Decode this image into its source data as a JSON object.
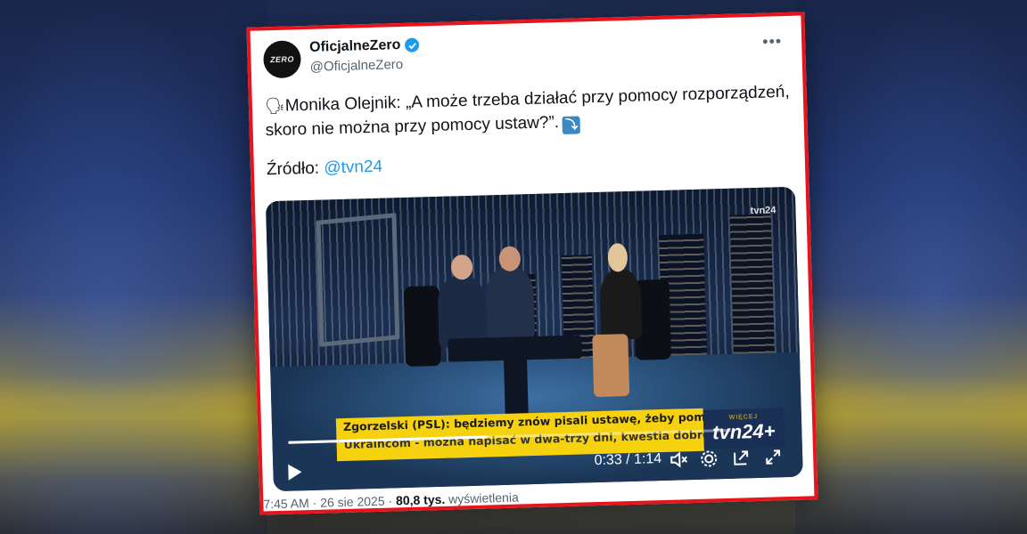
{
  "tweet": {
    "display_name": "OficjalneZero",
    "handle": "@OficjalneZero",
    "avatar_text": "ZERO",
    "text": "Monika Olejnik: „A może trzeba działać przy pomocy rozporządzeń, skoro nie można przy pomocy ustaw?”.",
    "source_label": "Źródło:",
    "source_link": "@tvn24",
    "more_label": "•••"
  },
  "video": {
    "ticker_line1": "Zgorzelski (PSL): będziemy znów pisali ustawę, żeby pomóc",
    "ticker_line2": "Ukraińcom - można napisać w dwa-trzy dni, kwestia dobrej woli",
    "channel_more": "WIĘCEJ",
    "channel_logo": "tvn24+",
    "corner_logo": "tvn24",
    "time": "0:33 / 1:14",
    "progress_fraction": 0.45
  },
  "footer": {
    "time": "7:45 AM · 26 sie 2025 ·",
    "views_count": "80,8 tys.",
    "views_label": "wyświetlenia"
  },
  "colors": {
    "frame_border": "#e8141c",
    "link": "#1d9bf0",
    "ticker": "#f6d20e",
    "verified": "#1d9bf0"
  }
}
